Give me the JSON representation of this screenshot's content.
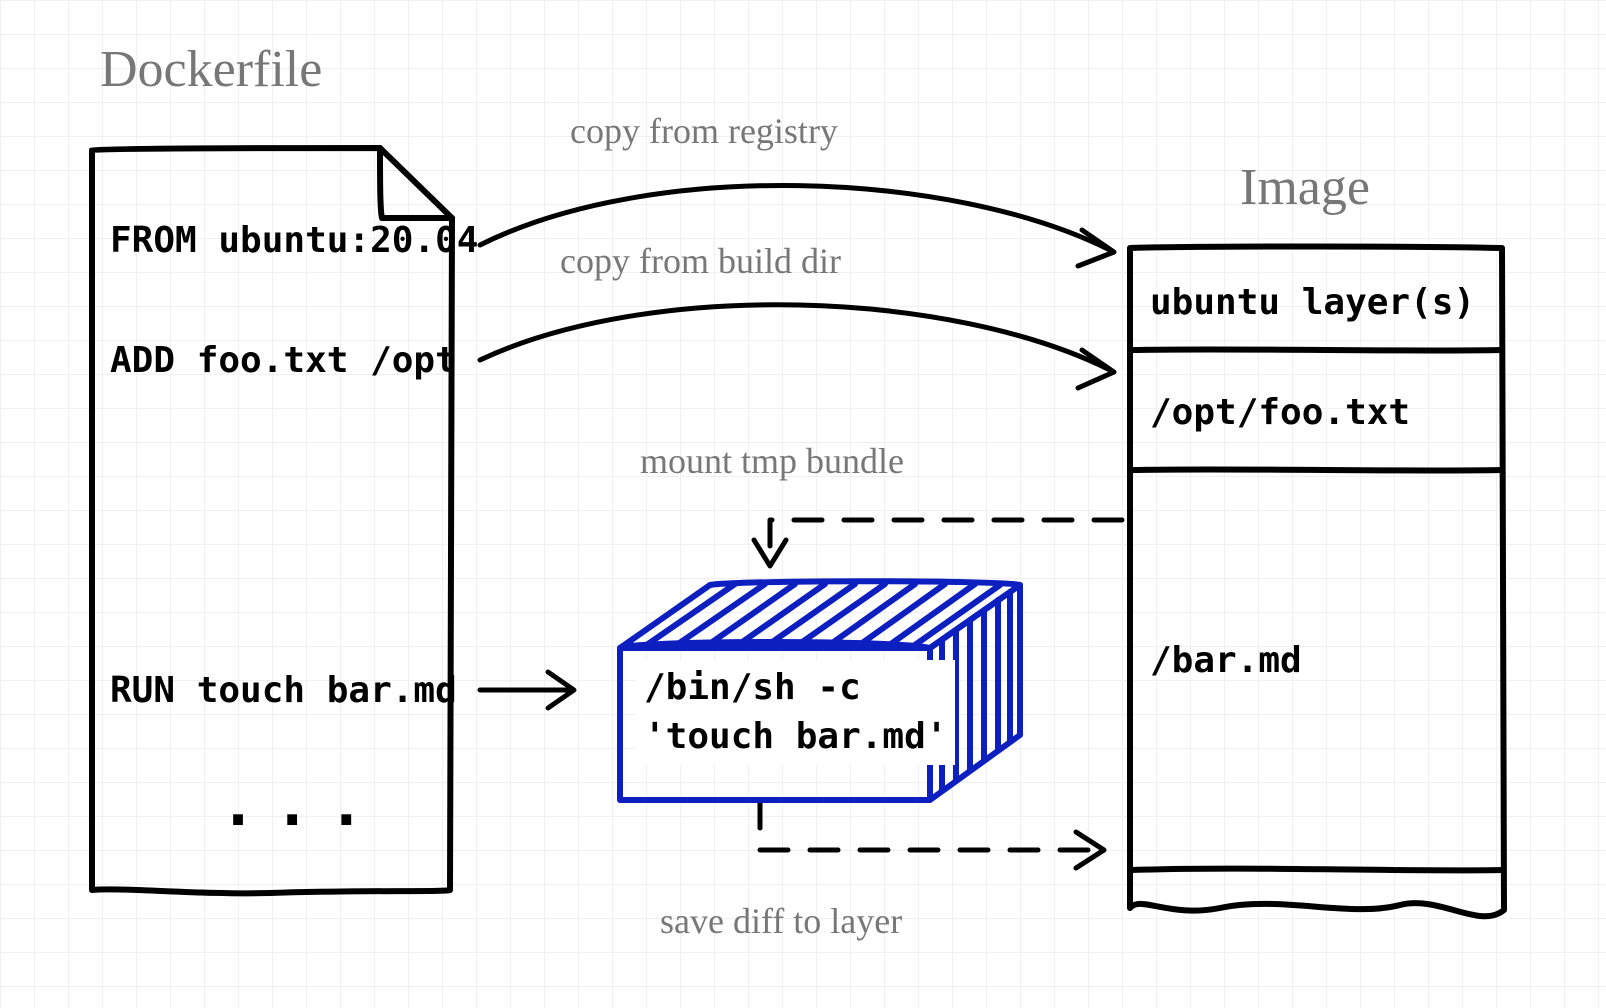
{
  "titles": {
    "left": "Dockerfile",
    "right": "Image"
  },
  "dockerfile": {
    "line_from": "FROM ubuntu:20.04",
    "line_add": "ADD foo.txt /opt",
    "line_run": "RUN touch bar.md",
    "dots": "..."
  },
  "image": {
    "layer1": "ubuntu layer(s)",
    "layer2": "/opt/foo.txt",
    "layer3": "/bar.md"
  },
  "container": {
    "cmd": "/bin/sh -c\n'touch bar.md'"
  },
  "labels": {
    "copy_registry": "copy from registry",
    "copy_builddir": "copy from build dir",
    "mount_bundle": "mount tmp bundle",
    "save_diff": "save diff to layer"
  },
  "colors": {
    "grid": "#f0f0f0",
    "ink_black": "#000000",
    "ink_grey": "#777777",
    "ink_blue": "#0d1fbf"
  }
}
